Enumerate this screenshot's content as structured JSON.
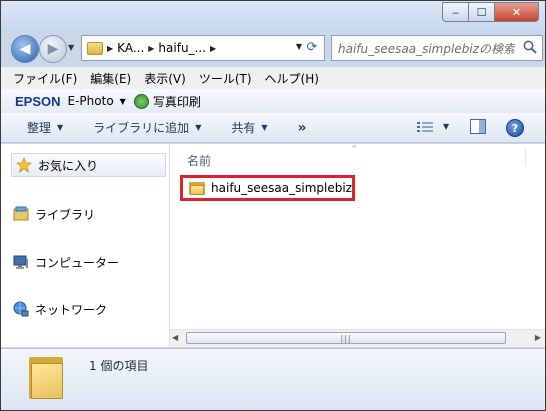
{
  "address": {
    "segments": [
      "KA...",
      "haifu_..."
    ]
  },
  "search": {
    "placeholder": "haifu_seesaa_simplebizの検索"
  },
  "menubar": {
    "items": [
      "ファイル(F)",
      "編集(E)",
      "表示(V)",
      "ツール(T)",
      "ヘルプ(H)"
    ]
  },
  "epson": {
    "brand": "EPSON",
    "app": "E-Photo",
    "print_label": "写真印刷"
  },
  "toolbar": {
    "organize": "整理",
    "add_to_library": "ライブラリに追加",
    "share": "共有",
    "more": "»"
  },
  "navpane": {
    "items": [
      "お気に入り",
      "ライブラリ",
      "コンピューター",
      "ネットワーク"
    ]
  },
  "content": {
    "column_name": "名前",
    "files": [
      {
        "name": "haifu_seesaa_simplebiz",
        "type": "folder",
        "highlighted": true
      }
    ]
  },
  "details": {
    "count_text": "1 個の項目"
  },
  "colors": {
    "highlight_border": "#e0202a",
    "accent": "#143a8c"
  },
  "icons": {
    "favorites": "star-icon",
    "library": "library-icon",
    "computer": "computer-icon",
    "network": "network-icon",
    "folder": "folder-icon"
  }
}
